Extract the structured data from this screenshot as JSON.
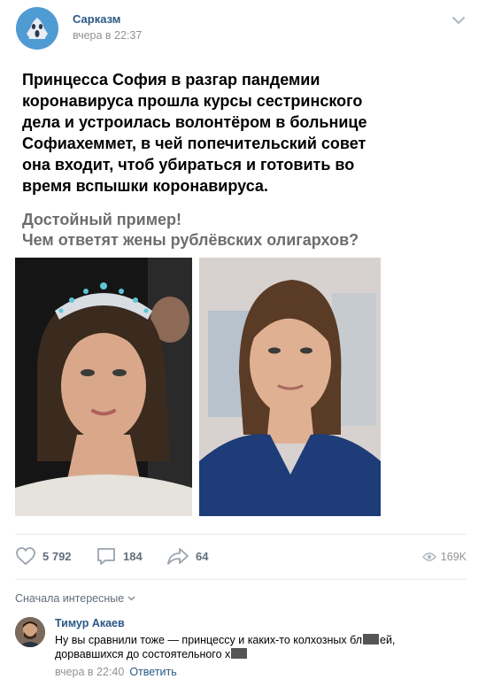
{
  "post": {
    "group_name": "Сарказм",
    "time": "вчера в 22:37",
    "text": "Принцесса София в разгар пандемии коронавируса прошла курсы сестринского дела и устроилась волонтёром в больнице Софиахеммет, в чей попечительский совет она входит, чтоб убираться и готовить во время вспышки коронавируса.",
    "subtext_line1": "Достойный пример!",
    "subtext_line2": "Чем ответят жены рублёвских олигархов?",
    "photos": [
      "photo-tiara-gown",
      "photo-scrubs"
    ]
  },
  "actions": {
    "likes": "5 792",
    "comments": "184",
    "shares": "64",
    "views": "169K"
  },
  "comments_section": {
    "sort_label": "Сначала интересные",
    "comment": {
      "author": "Тимур Акаев",
      "text_part1": "Ну вы сравнили тоже — принцессу и каких-то колхозных бл",
      "text_part2": "ей,",
      "text_part3": "дорвавшихся до состоятельного х",
      "time": "вчера в 22:40",
      "reply_label": "Ответить"
    }
  },
  "colors": {
    "link": "#2a5885",
    "muted": "#939393",
    "action": "#626d7a",
    "sub_text": "#6d6d6d"
  }
}
